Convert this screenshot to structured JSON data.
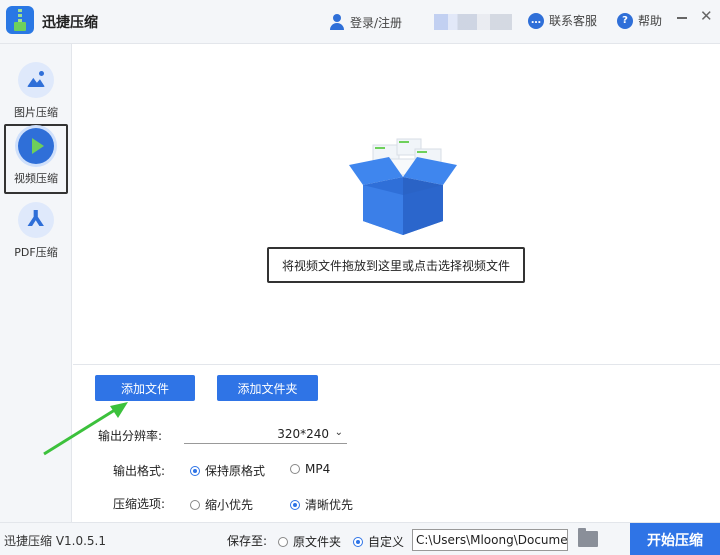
{
  "app": {
    "title": "迅捷压缩"
  },
  "header": {
    "login_label": "登录/注册",
    "contact_label": "联系客服",
    "help_label": "帮助"
  },
  "sidebar": {
    "items": [
      {
        "label": "图片压缩",
        "icon": "image-icon",
        "active": false
      },
      {
        "label": "视频压缩",
        "icon": "video-play-icon",
        "active": true
      },
      {
        "label": "PDF压缩",
        "icon": "pdf-icon",
        "active": false
      }
    ]
  },
  "dropzone": {
    "hint": "将视频文件拖放到这里或点击选择视频文件"
  },
  "buttons": {
    "add_file": "添加文件",
    "add_folder": "添加文件夹"
  },
  "settings": {
    "resolution_label": "输出分辨率:",
    "resolution_value": "320*240",
    "format_label": "输出格式:",
    "format_options": [
      "保持原格式",
      "MP4"
    ],
    "format_selected": "保持原格式",
    "compress_label": "压缩选项:",
    "compress_options": [
      "缩小优先",
      "清晰优先"
    ],
    "compress_selected": "清晰优先"
  },
  "footer": {
    "version": "迅捷压缩 V1.0.5.1",
    "save_to_label": "保存至:",
    "save_options": [
      "原文件夹",
      "自定义"
    ],
    "save_selected": "自定义",
    "path_value": "C:\\Users\\Mloong\\Documents",
    "start_label": "开始压缩"
  },
  "colors": {
    "accent": "#2f74e6",
    "green": "#6ed05a",
    "sidebar_bg": "#f4f6f9"
  }
}
